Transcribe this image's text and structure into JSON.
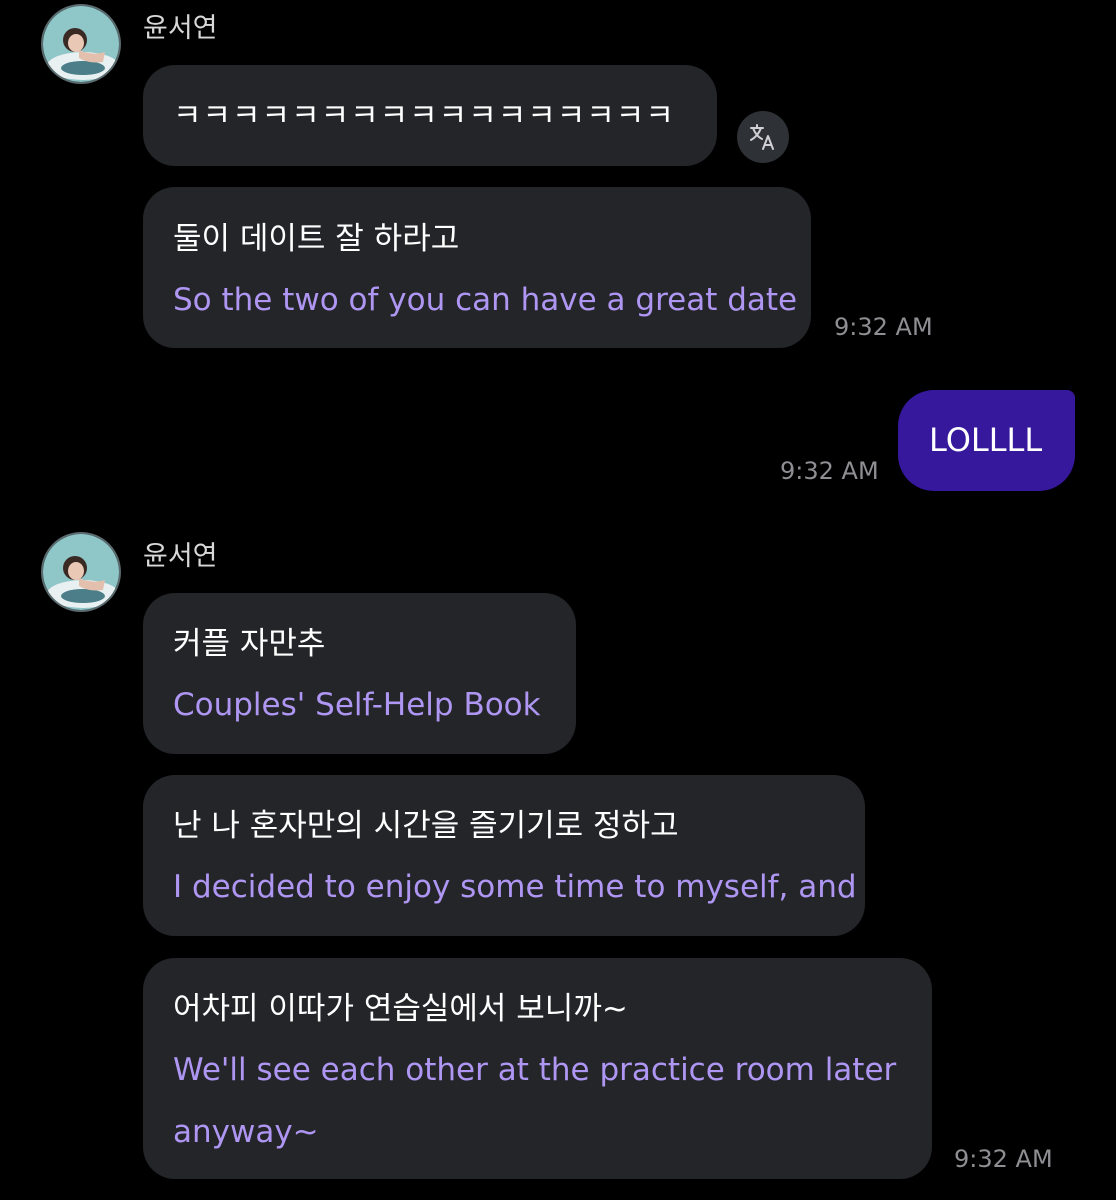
{
  "sender": {
    "name": "윤서연"
  },
  "messages": [
    {
      "ko": "ㅋㅋㅋㅋㅋㅋㅋㅋㅋㅋㅋㅋㅋㅋㅋㅋㅋ"
    },
    {
      "ko": "둘이 데이트 잘 하라고",
      "en": "So the two of you can have a great date",
      "time": "9:32 AM"
    },
    {
      "own": "LOLLLL",
      "time": "9:32 AM"
    },
    {
      "ko": "커플 자만추",
      "en": "Couples' Self-Help Book"
    },
    {
      "ko": "난 나 혼자만의 시간을 즐기기로 정하고",
      "en": "I decided to enjoy some time to myself, and"
    },
    {
      "ko": "어차피 이따가 연습실에서 보니까~",
      "en_line1": "We'll see each other at the practice room later",
      "en_line2": "anyway~",
      "time": "9:32 AM"
    }
  ],
  "colors": {
    "background": "#000000",
    "bubble": "#232529",
    "own_bubble": "#35189c",
    "translation_text": "#ae96f2",
    "timestamp": "#8e8e93"
  },
  "icons": {
    "translate": "translate-icon",
    "avatar": "profile-photo"
  }
}
